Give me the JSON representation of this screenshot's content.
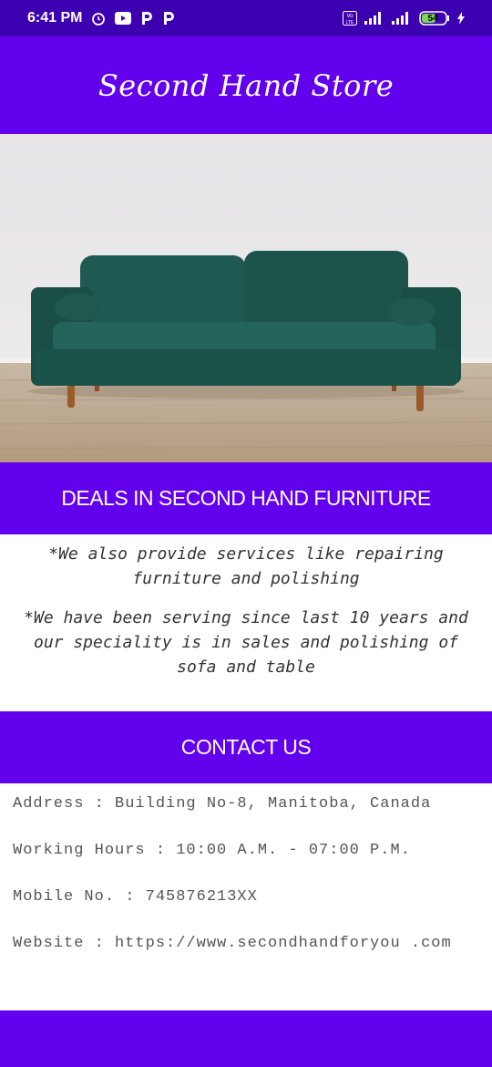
{
  "status_bar": {
    "time": "6:41 PM",
    "battery": "54"
  },
  "header": {
    "title": "Second Hand Store"
  },
  "banner": {
    "deals_text": "DEALS IN SECOND HAND FURNITURE"
  },
  "info": {
    "line1": "*We also provide services like repairing furniture and polishing",
    "line2": "*We have been serving since last 10 years and our speciality is in sales and polishing of sofa and table"
  },
  "contact_section": {
    "heading": "CONTACT US",
    "address": "Address : Building No-8, Manitoba, Canada",
    "hours": "Working Hours : 10:00 A.M. - 07:00 P.M.",
    "mobile": "Mobile No. : 745876213XX",
    "website": "Website : https://www.secondhandforyou .com"
  },
  "colors": {
    "primary": "#6200ee",
    "status_bar": "#3d00b0",
    "sofa": "#1f5a52"
  }
}
